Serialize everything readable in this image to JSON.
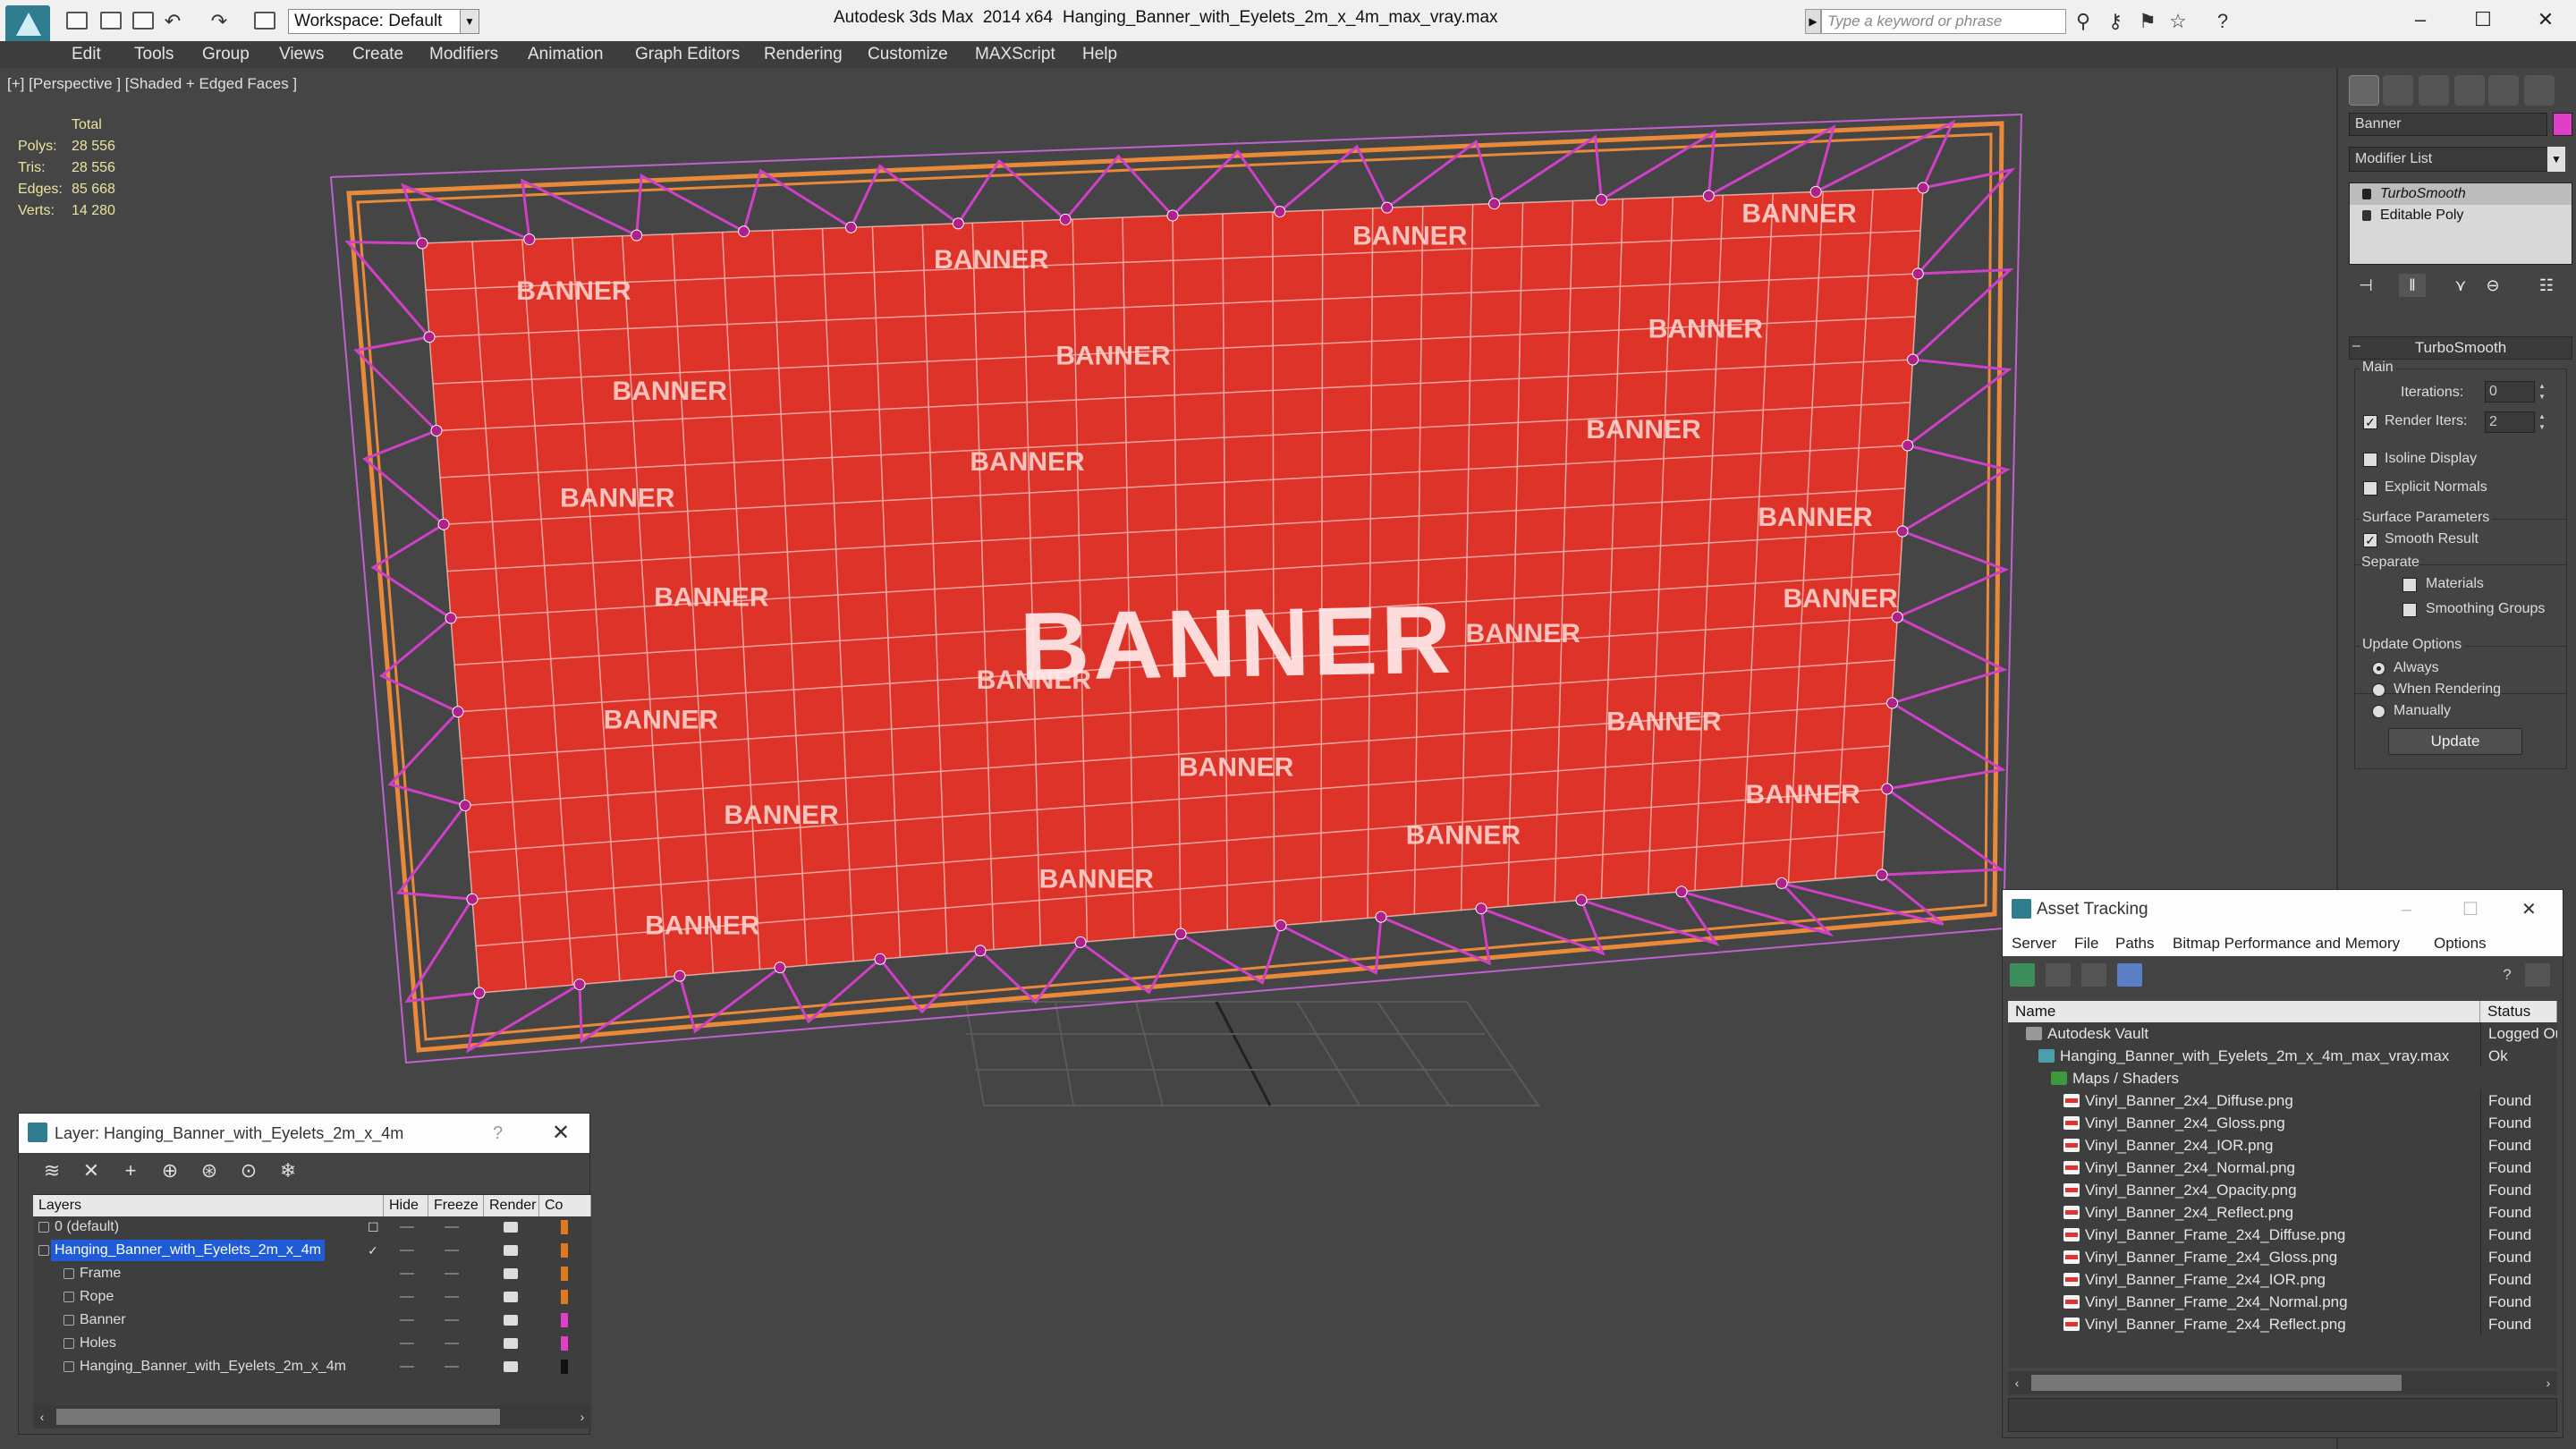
{
  "window": {
    "app_title": "Autodesk 3ds Max  2014 x64",
    "file_name": "Hanging_Banner_with_Eyelets_2m_x_4m_max_vray.max",
    "workspace": "Workspace: Default",
    "search_placeholder": "Type a keyword or phrase",
    "minimize": "–",
    "maximize": "☐",
    "close": "✕"
  },
  "menu": [
    "Edit",
    "Tools",
    "Group",
    "Views",
    "Create",
    "Modifiers",
    "Animation",
    "Graph Editors",
    "Rendering",
    "Customize",
    "MAXScript",
    "Help"
  ],
  "viewport": {
    "label": "[+] [Perspective ] [Shaded + Edged Faces ]",
    "stats": {
      "header": "Total",
      "rows": [
        {
          "label": "Polys:",
          "value": "28 556"
        },
        {
          "label": "Tris:",
          "value": "28 556"
        },
        {
          "label": "Edges:",
          "value": "85 668"
        },
        {
          "label": "Verts:",
          "value": "14 280"
        }
      ]
    },
    "banner_text": "BANNER"
  },
  "command_panel": {
    "object_name": "Banner",
    "object_color": "#e040c8",
    "modifier_list": "Modifier List",
    "stack": [
      "TurboSmooth",
      "Editable Poly"
    ],
    "rollout_title": "TurboSmooth",
    "main_label": "Main",
    "iterations_label": "Iterations:",
    "iterations_value": "0",
    "render_iters_label": "Render Iters:",
    "render_iters_value": "2",
    "render_iters_checked": true,
    "isoline_label": "Isoline Display",
    "explicit_normals_label": "Explicit Normals",
    "surface_params_label": "Surface Parameters",
    "smooth_result_label": "Smooth Result",
    "separate_label": "Separate",
    "materials_label": "Materials",
    "smoothing_groups_label": "Smoothing Groups",
    "update_options_label": "Update Options",
    "always_label": "Always",
    "when_rendering_label": "When Rendering",
    "manually_label": "Manually",
    "update_button": "Update"
  },
  "layer_dialog": {
    "title": "Layer: Hanging_Banner_with_Eyelets_2m_x_4m",
    "help": "?",
    "close": "✕",
    "columns": [
      "Layers",
      "Hide",
      "Freeze",
      "Render",
      "Co"
    ],
    "rows": [
      {
        "name": "0 (default)",
        "indent": 0,
        "selected": false,
        "color": "#e07820"
      },
      {
        "name": "Hanging_Banner_with_Eyelets_2m_x_4m",
        "indent": 0,
        "selected": true,
        "color": "#e07820"
      },
      {
        "name": "Frame",
        "indent": 1,
        "selected": false,
        "color": "#e07820"
      },
      {
        "name": "Rope",
        "indent": 1,
        "selected": false,
        "color": "#e07820"
      },
      {
        "name": "Banner",
        "indent": 1,
        "selected": false,
        "color": "#e040c8"
      },
      {
        "name": "Holes",
        "indent": 1,
        "selected": false,
        "color": "#e040c8"
      },
      {
        "name": "Hanging_Banner_with_Eyelets_2m_x_4m",
        "indent": 1,
        "selected": false,
        "color": "#111111"
      }
    ]
  },
  "asset_tracking": {
    "title": "Asset Tracking",
    "menu": [
      "Server",
      "File",
      "Paths",
      "Bitmap Performance and Memory",
      "Options"
    ],
    "columns": [
      "Name",
      "Status"
    ],
    "rows": [
      {
        "name": "Autodesk Vault",
        "status": "Logged Ou",
        "indent": 0,
        "icon": "vault-icon"
      },
      {
        "name": "Hanging_Banner_with_Eyelets_2m_x_4m_max_vray.max",
        "status": "Ok",
        "indent": 1,
        "icon": "max-file-icon"
      },
      {
        "name": "Maps / Shaders",
        "status": "",
        "indent": 2,
        "icon": "maps-folder-icon"
      },
      {
        "name": "Vinyl_Banner_2x4_Diffuse.png",
        "status": "Found",
        "indent": 3,
        "icon": "png-icon"
      },
      {
        "name": "Vinyl_Banner_2x4_Gloss.png",
        "status": "Found",
        "indent": 3,
        "icon": "png-icon"
      },
      {
        "name": "Vinyl_Banner_2x4_IOR.png",
        "status": "Found",
        "indent": 3,
        "icon": "png-icon"
      },
      {
        "name": "Vinyl_Banner_2x4_Normal.png",
        "status": "Found",
        "indent": 3,
        "icon": "png-icon"
      },
      {
        "name": "Vinyl_Banner_2x4_Opacity.png",
        "status": "Found",
        "indent": 3,
        "icon": "png-icon"
      },
      {
        "name": "Vinyl_Banner_2x4_Reflect.png",
        "status": "Found",
        "indent": 3,
        "icon": "png-icon"
      },
      {
        "name": "Vinyl_Banner_Frame_2x4_Diffuse.png",
        "status": "Found",
        "indent": 3,
        "icon": "png-icon"
      },
      {
        "name": "Vinyl_Banner_Frame_2x4_Gloss.png",
        "status": "Found",
        "indent": 3,
        "icon": "png-icon"
      },
      {
        "name": "Vinyl_Banner_Frame_2x4_IOR.png",
        "status": "Found",
        "indent": 3,
        "icon": "png-icon"
      },
      {
        "name": "Vinyl_Banner_Frame_2x4_Normal.png",
        "status": "Found",
        "indent": 3,
        "icon": "png-icon"
      },
      {
        "name": "Vinyl_Banner_Frame_2x4_Reflect.png",
        "status": "Found",
        "indent": 3,
        "icon": "png-icon"
      }
    ]
  }
}
